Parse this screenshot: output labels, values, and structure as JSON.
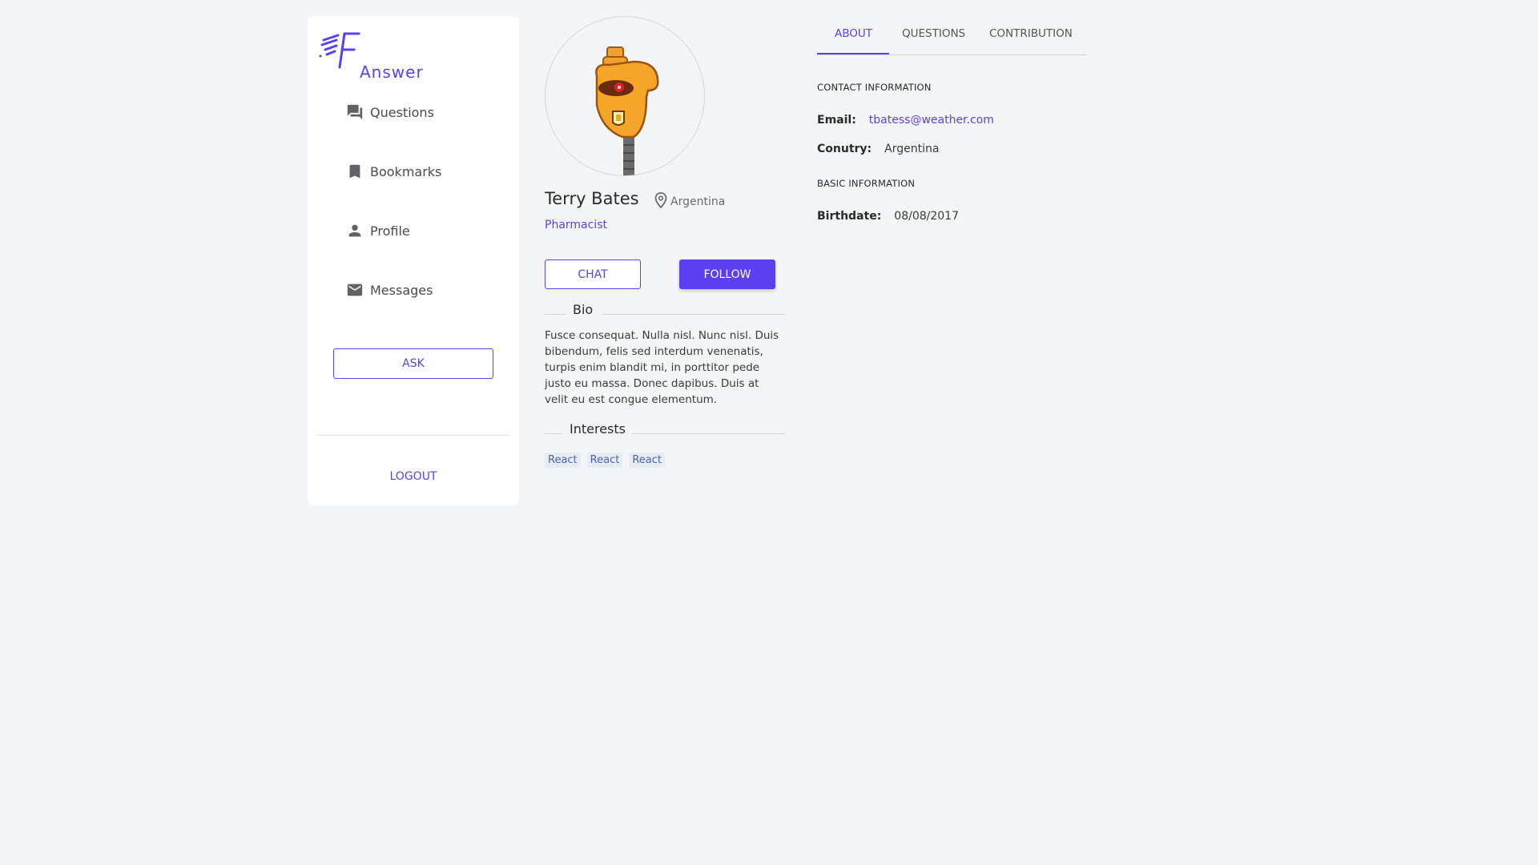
{
  "brand": {
    "name": "Answer",
    "color": "#5b3ff0"
  },
  "sidebar": {
    "items": [
      {
        "label": "Questions",
        "icon": "question-answer-icon"
      },
      {
        "label": "Bookmarks",
        "icon": "bookmark-icon"
      },
      {
        "label": "Profile",
        "icon": "person-icon"
      },
      {
        "label": "Messages",
        "icon": "mail-icon"
      }
    ],
    "ask_label": "ASK",
    "logout_label": "LOGOUT"
  },
  "profile": {
    "name": "Terry Bates",
    "location": "Argentina",
    "profession": "Pharmacist",
    "chat_label": "CHAT",
    "follow_label": "FOLLOW",
    "bio_title": "Bio",
    "bio": "Fusce consequat. Nulla nisl. Nunc nisl. Duis bibendum, felis sed interdum venenatis, turpis enim blandit mi, in porttitor pede justo eu massa. Donec dapibus. Duis at velit eu est congue elementum.",
    "interests_title": "Interests",
    "interests": [
      "React",
      "React",
      "React"
    ]
  },
  "tabs": [
    {
      "label": "ABOUT",
      "active": true
    },
    {
      "label": "QUESTIONS",
      "active": false
    },
    {
      "label": "CONTRIBUTION",
      "active": false
    }
  ],
  "about": {
    "contact_heading": "CONTACT INFORMATION",
    "email_label": "Email:",
    "email": "tbatess@weather.com",
    "country_label": "Conutry:",
    "country": "Argentina",
    "basic_heading": "BASIC INFORMATION",
    "birthdate_label": "Birthdate:",
    "birthdate": "08/08/2017"
  }
}
